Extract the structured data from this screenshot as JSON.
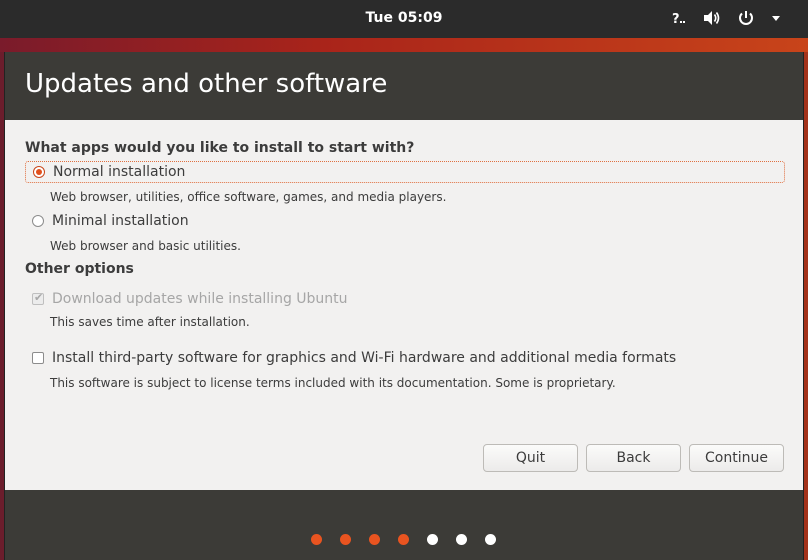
{
  "panel": {
    "clock": "Tue 05:09"
  },
  "window": {
    "title": "Updates and other software"
  },
  "install_section": {
    "heading": "What apps would you like to install to start with?",
    "options": [
      {
        "label": "Normal installation",
        "description": "Web browser, utilities, office software, games, and media players.",
        "selected": true
      },
      {
        "label": "Minimal installation",
        "description": "Web browser and basic utilities.",
        "selected": false
      }
    ]
  },
  "other_section": {
    "heading": "Other options",
    "options": [
      {
        "label": "Download updates while installing Ubuntu",
        "description": "This saves time after installation.",
        "checked": true,
        "disabled": true
      },
      {
        "label": "Install third-party software for graphics and Wi-Fi hardware and additional media formats",
        "description": "This software is subject to license terms included with its documentation. Some is proprietary.",
        "checked": false,
        "disabled": false
      }
    ]
  },
  "buttons": {
    "quit": "Quit",
    "back": "Back",
    "continue": "Continue"
  },
  "progress": {
    "total_steps": 7,
    "completed_steps": 4,
    "completed_color": "#e95420",
    "pending_color": "#ffffff"
  },
  "colors": {
    "accent": "#e95420",
    "header_bg": "#3c3b37"
  }
}
